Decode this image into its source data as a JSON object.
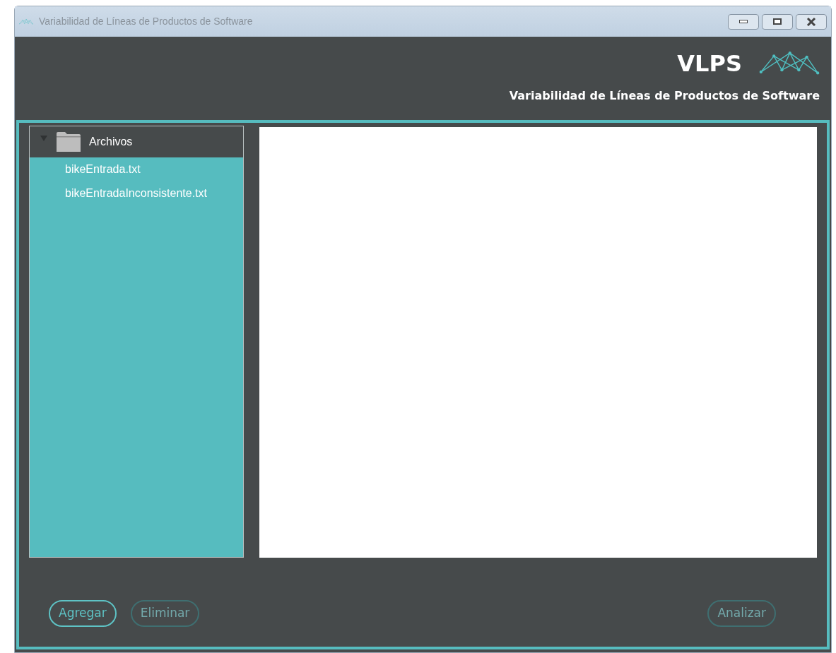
{
  "window": {
    "title": "Variabilidad de Líneas de Productos de Software"
  },
  "header": {
    "logo_text": "VLPS",
    "subtitle": "Variabilidad de Líneas de Productos de Software"
  },
  "tree": {
    "label": "Archivos",
    "expanded": true,
    "children": [
      {
        "label": "bikeEntrada.txt"
      },
      {
        "label": "bikeEntradaInconsistente.txt"
      }
    ]
  },
  "left_buttons": [
    {
      "label": "Agregar",
      "disabled": false
    },
    {
      "label": "Eliminar",
      "disabled": true
    }
  ],
  "right_buttons": [
    {
      "label": "Analizar",
      "disabled": true
    }
  ]
}
